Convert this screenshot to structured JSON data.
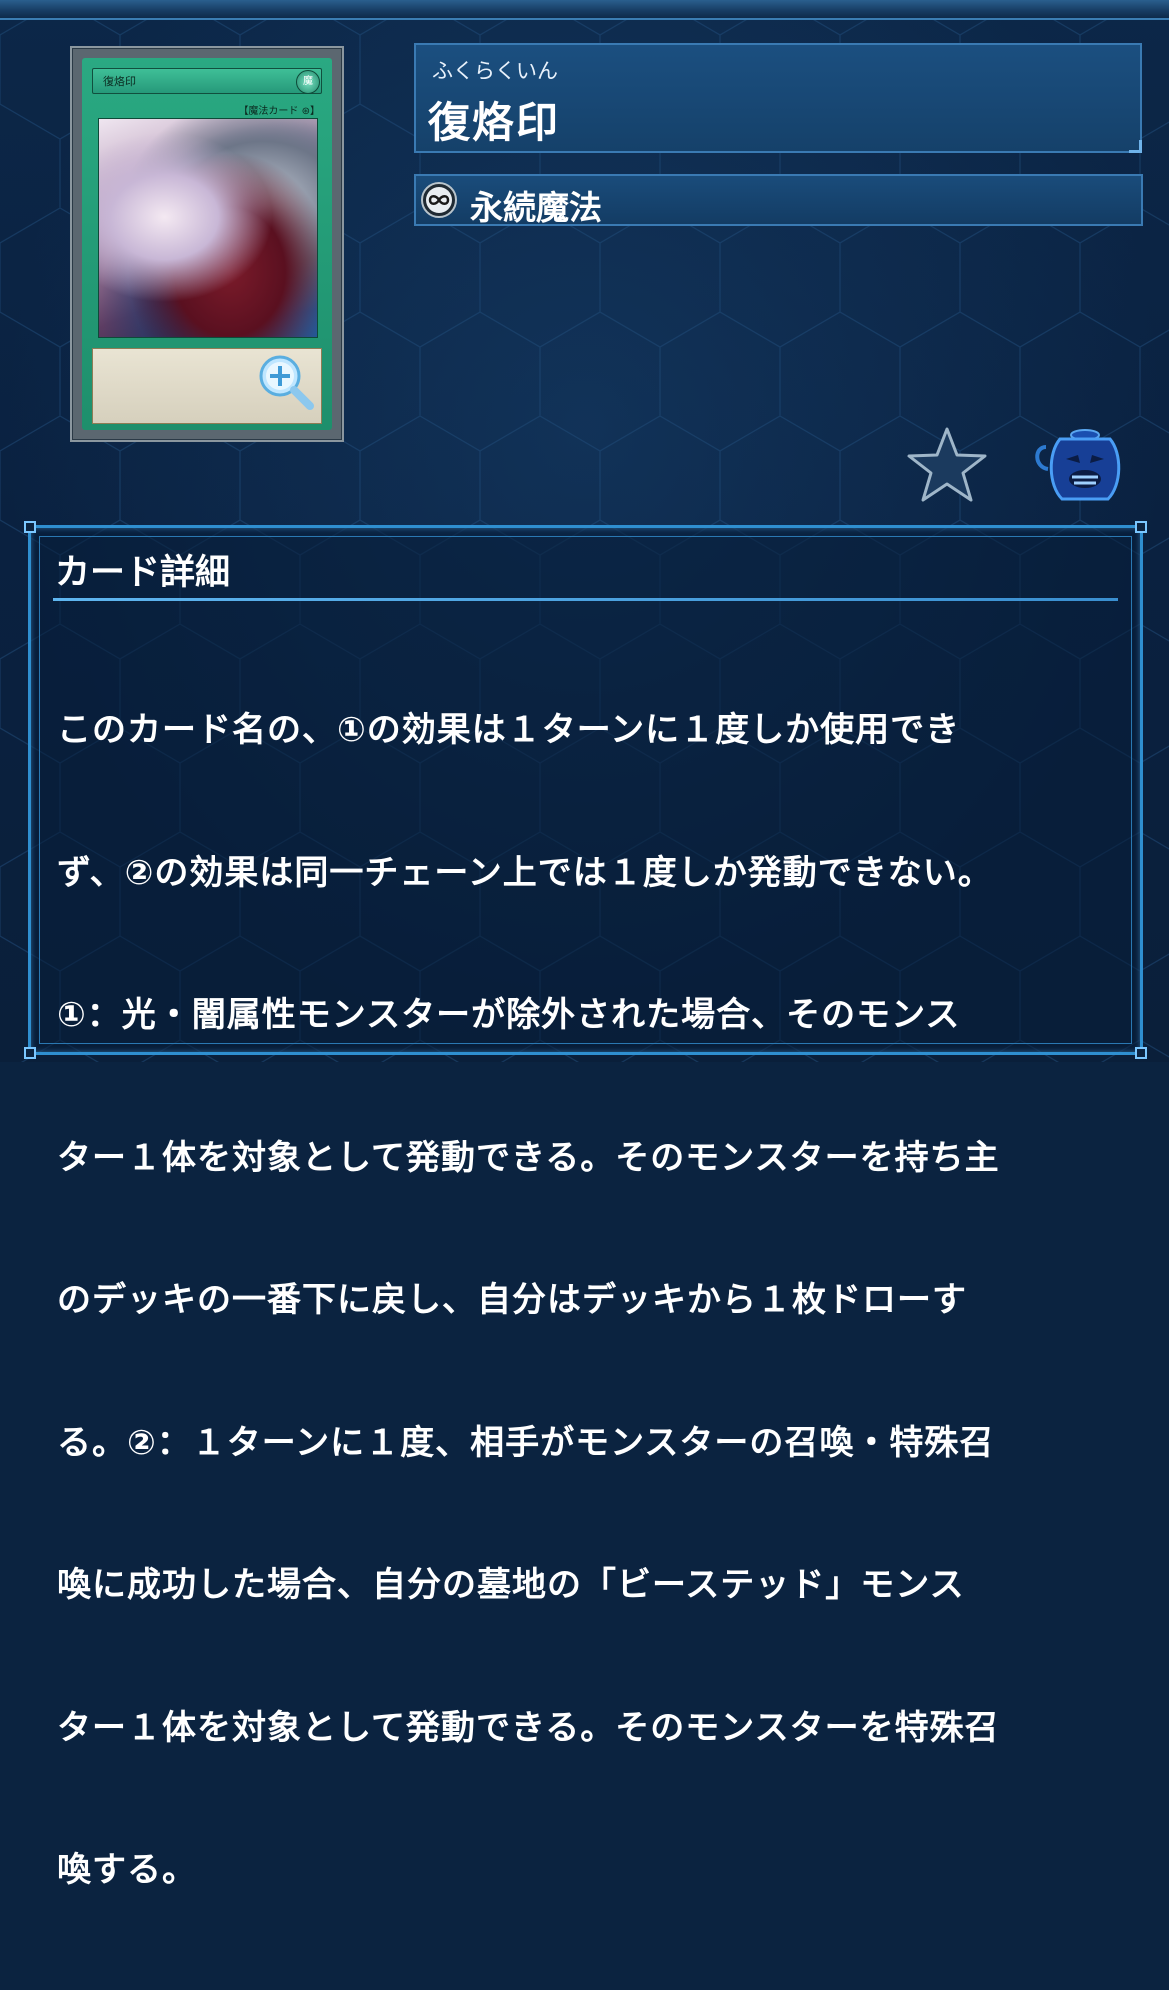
{
  "card": {
    "thumb_name": "復烙印",
    "thumb_attribute": "魔",
    "thumb_type_line": "【魔法カード ⊛】",
    "name_ruby": "ふくらくいん",
    "name": "復烙印",
    "type_label": "永続魔法",
    "type_icon": "infinity-icon"
  },
  "actions": {
    "zoom_icon": "zoom-in-icon",
    "favorite_icon": "star-icon",
    "pot_icon": "pot-of-greed-icon"
  },
  "detail": {
    "heading": "カード詳細",
    "lines": [
      "このカード名の、①の効果は１ターンに１度しか使用でき",
      "ず、②の効果は同一チェーン上では１度しか発動できない。",
      "①：光・闇属性モンスターが除外された場合、そのモンス",
      "ター１体を対象として発動できる。そのモンスターを持ち主",
      "のデッキの一番下に戻し、自分はデッキから１枚ドローす",
      "る。②：１ターンに１度、相手がモンスターの召喚・特殊召",
      "喚に成功した場合、自分の墓地の「ビーステッド」モンス",
      "ター１体を対象として発動できる。そのモンスターを特殊召",
      "喚する。"
    ]
  },
  "colors": {
    "background": "#0b2340",
    "panel_border": "#3a7ab3",
    "detail_border": "#2f8fd0",
    "spell_card_green": "#1e8f6c"
  }
}
